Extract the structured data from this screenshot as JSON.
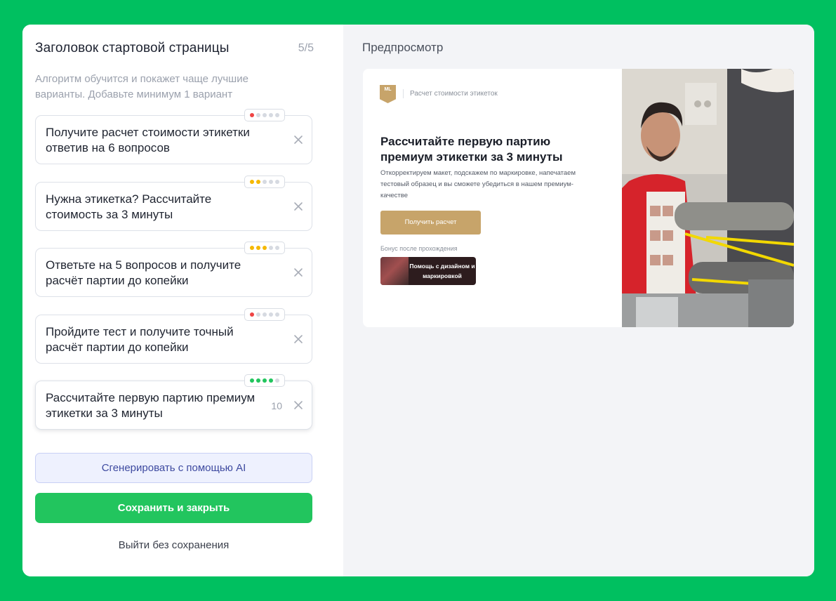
{
  "editor": {
    "title": "Заголовок стартовой страницы",
    "counter": "5/5",
    "subtitle": "Алгоритм обучится и покажет чаще лучшие варианты. Добавьте минимум 1 вариант",
    "variants": [
      {
        "text": "Получите расчет стоимости этикетки ответив на 6 вопросов",
        "rating": 1,
        "rating_color": "#ef4444"
      },
      {
        "text": "Нужна этикетка? Рассчитайте стоимость за 3 минуты",
        "rating": 2,
        "rating_color": "#f5b800"
      },
      {
        "text": "Ответьте на 5 вопросов и получите расчёт партии до копейки",
        "rating": 3,
        "rating_color": "#f5b800"
      },
      {
        "text": "Пройдите тест и получите точный расчёт партии до копейки",
        "rating": 1,
        "rating_color": "#ef4444"
      },
      {
        "text": "Рассчитайте первую партию премиум этикетки за 3 минуты",
        "rating": 4,
        "rating_color": "#22c55e",
        "char_count": "10"
      }
    ],
    "rating_max": 5,
    "ai_button": "Сгенерировать с помощью AI",
    "save_button": "Сохранить и закрыть",
    "exit_button": "Выйти без сохранения"
  },
  "preview": {
    "label": "Предпросмотр",
    "card": {
      "logo_text": "ML",
      "brand_subtitle": "Расчет стоимости этикеток",
      "heading": "Рассчитайте первую партию премиум этикетки за 3 минуты",
      "description": "Откорректируем макет, подскажем по маркировке, напечатаем тестовый образец и вы сможете убедиться в нашем премиум-качестве",
      "cta": "Получить расчет",
      "bonus_label": "Бонус после прохождения",
      "bonus_text": "Помощь с дизайном и маркировкой"
    }
  },
  "colors": {
    "background": "#00c060",
    "accent_green": "#22c55e",
    "gold": "#c7a46a",
    "ai_button_bg": "#eef1fe"
  }
}
